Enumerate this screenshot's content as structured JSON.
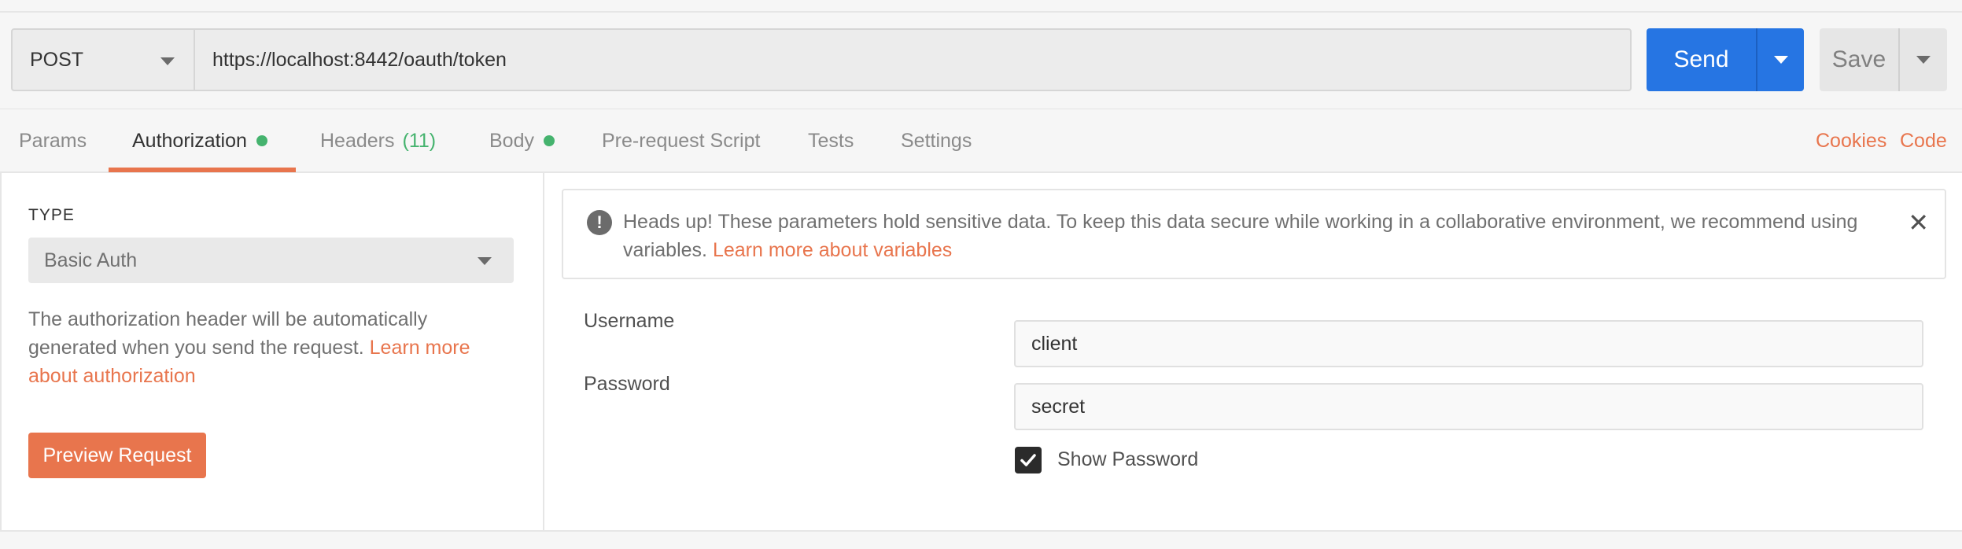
{
  "request": {
    "method": "POST",
    "url": "https://localhost:8442/oauth/token",
    "send_label": "Send",
    "save_label": "Save"
  },
  "tabs": {
    "params": "Params",
    "authorization": "Authorization",
    "headers": "Headers",
    "headers_count": "(11)",
    "body": "Body",
    "prerequest": "Pre-request Script",
    "tests": "Tests",
    "settings": "Settings",
    "cookies": "Cookies",
    "code": "Code"
  },
  "auth": {
    "type_label": "TYPE",
    "type_value": "Basic Auth",
    "description": "The authorization header will be automatically generated when you send the request.",
    "learn_more": "Learn more about authorization",
    "preview_button": "Preview Request"
  },
  "alert": {
    "text": "Heads up! These parameters hold sensitive data. To keep this data secure while working in a collaborative environment, we recommend using variables.",
    "link": "Learn more about variables"
  },
  "form": {
    "username_label": "Username",
    "username_value": "client",
    "password_label": "Password",
    "password_value": "secret",
    "show_password_label": "Show Password",
    "show_password_checked": true
  },
  "colors": {
    "accent": "#e8754d",
    "send": "#2675e3",
    "indicator": "#45b36e"
  }
}
